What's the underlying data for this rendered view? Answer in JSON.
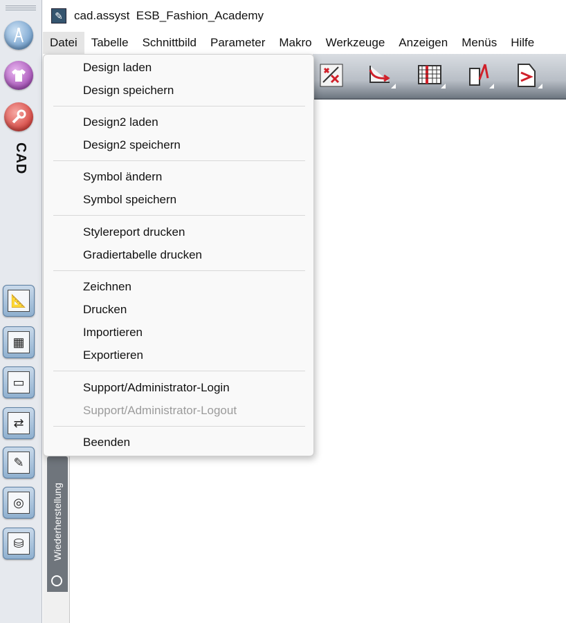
{
  "app": {
    "title": "cad.assyst  ESB_Fashion_Academy",
    "launcher_label": "CAD"
  },
  "menubar": [
    {
      "label": "Datei",
      "active": true
    },
    {
      "label": "Tabelle"
    },
    {
      "label": "Schnittbild"
    },
    {
      "label": "Parameter"
    },
    {
      "label": "Makro"
    },
    {
      "label": "Werkzeuge"
    },
    {
      "label": "Anzeigen"
    },
    {
      "label": "Menüs"
    },
    {
      "label": "Hilfe"
    }
  ],
  "datei_menu": {
    "items": [
      {
        "label": "Design laden",
        "enabled": true
      },
      {
        "label": "Design speichern",
        "enabled": true
      },
      {
        "label": "Design2 laden",
        "enabled": true
      },
      {
        "label": "Design2 speichern",
        "enabled": true
      },
      {
        "label": "Symbol ändern",
        "enabled": true
      },
      {
        "label": "Symbol speichern",
        "enabled": true
      },
      {
        "label": "Stylereport drucken",
        "enabled": true
      },
      {
        "label": "Gradiertabelle drucken",
        "enabled": true
      },
      {
        "label": "Zeichnen",
        "enabled": true
      },
      {
        "label": "Drucken",
        "enabled": true
      },
      {
        "label": "Importieren",
        "enabled": true
      },
      {
        "label": "Exportieren",
        "enabled": true
      },
      {
        "label": "Support/Administrator-Login",
        "enabled": true
      },
      {
        "label": "Support/Administrator-Logout",
        "enabled": false
      },
      {
        "label": "Beenden",
        "enabled": true
      }
    ]
  },
  "dock_panel": {
    "tab_label": "Wiederherstellung"
  },
  "colors": {
    "launcher_bg": "#e6e9ee",
    "toolbar_accent": "#d0202a",
    "disabled_text": "#9b9b9b",
    "dock_tab": "#6f757c"
  },
  "icons": [
    "compass-icon",
    "shirt-icon",
    "wrench-icon",
    "drafting-icon",
    "calculator-icon",
    "plotter-icon",
    "exchange-icon",
    "notepad-icon",
    "globe-icon",
    "database-icon"
  ]
}
